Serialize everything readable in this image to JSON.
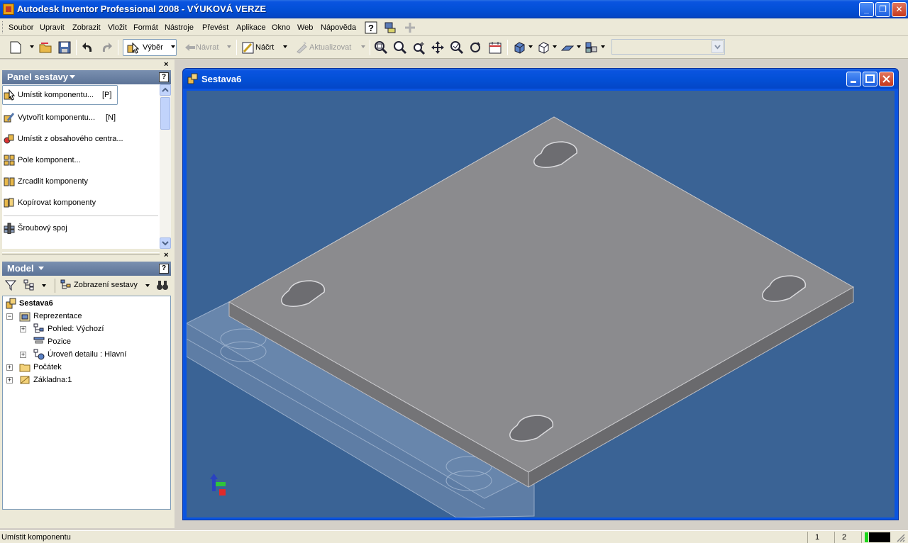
{
  "app": {
    "title": "Autodesk Inventor Professional 2008 - VÝUKOVÁ VERZE",
    "window_buttons": [
      "_",
      "❐",
      "✕"
    ]
  },
  "menu": {
    "items": [
      "Soubor",
      "Upravit",
      "Zobrazit",
      "Vložit",
      "Formát",
      "Nástroje",
      "Převést",
      "Aplikace",
      "Okno",
      "Web",
      "Nápověda"
    ]
  },
  "toolbar": {
    "select_label": "Výběr",
    "back_label": "Návrat",
    "sketch_label": "Náčrt",
    "update_label": "Aktualizovat"
  },
  "assembly_panel": {
    "title": "Panel sestavy",
    "help": "?",
    "items": [
      {
        "label": "Umístit komponentu...",
        "key": "[P]",
        "icon": "place-component-icon"
      },
      {
        "label": "Vytvořit komponentu...",
        "key": "[N]",
        "icon": "create-component-icon"
      },
      {
        "label": "Umístit z obsahového centra...",
        "key": "",
        "icon": "content-center-icon"
      },
      {
        "label": "Pole komponent...",
        "key": "",
        "icon": "component-pattern-icon"
      },
      {
        "label": "Zrcadlit komponenty",
        "key": "",
        "icon": "mirror-components-icon"
      },
      {
        "label": "Kopírovat komponenty",
        "key": "",
        "icon": "copy-components-icon"
      },
      {
        "label": "Šroubový spoj",
        "key": "",
        "icon": "bolted-connection-icon"
      }
    ]
  },
  "model_panel": {
    "title": "Model",
    "help": "?",
    "view_label": "Zobrazení sestavy",
    "tree": [
      {
        "label": "Sestava6",
        "level": 0,
        "expander": "",
        "bold": true
      },
      {
        "label": "Reprezentace",
        "level": 1,
        "expander": "−"
      },
      {
        "label": "Pohled: Výchozí",
        "level": 2,
        "expander": "+"
      },
      {
        "label": "Pozice",
        "level": 2,
        "expander": ""
      },
      {
        "label": "Úroveň detailu : Hlavní",
        "level": 2,
        "expander": "+"
      },
      {
        "label": "Počátek",
        "level": 1,
        "expander": "+"
      },
      {
        "label": "Základna:1",
        "level": 1,
        "expander": "+"
      }
    ]
  },
  "document": {
    "title": "Sestava6"
  },
  "status": {
    "message": "Umístit komponentu",
    "cell1": "1",
    "cell2": "2"
  },
  "colors": {
    "viewport_bg": "#3a6395",
    "plate_top": "#8a8a8c",
    "plate_side": "#6b6b6e",
    "xp_blue": "#0a54e0"
  }
}
